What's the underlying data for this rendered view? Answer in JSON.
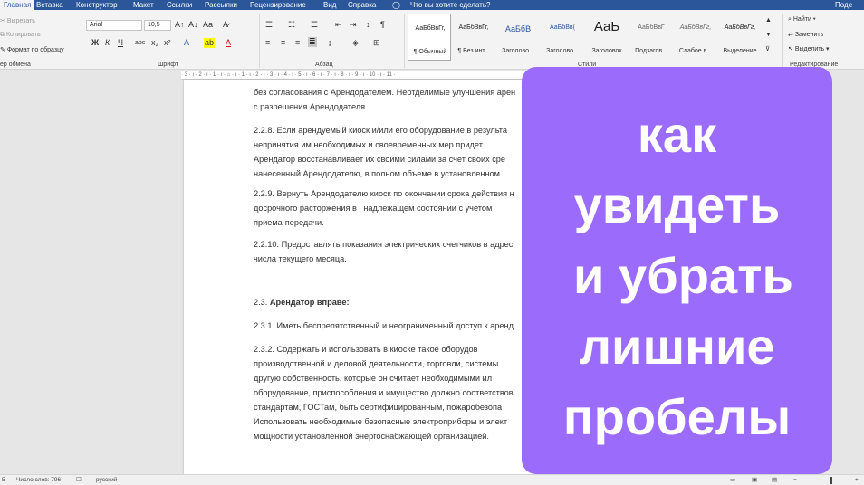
{
  "ribbon_tabs": [
    "Главная",
    "Вставка",
    "Конструктор",
    "Макет",
    "Ссылки",
    "Рассылки",
    "Рецензирование",
    "Вид",
    "Справка"
  ],
  "tell_me": "Что вы хотите сделать?",
  "account": "Поде",
  "clipboard": {
    "cut": "Вырезать",
    "copy": "Копировать",
    "format_painter": "Формат по образцу",
    "group": "ер обмена"
  },
  "font": {
    "name": "Arial",
    "size": "10,5",
    "group": "Шрифт",
    "buttons": [
      "Ж",
      "К",
      "Ч",
      "abc",
      "x₂",
      "x²"
    ]
  },
  "paragraph": {
    "group": "Абзац"
  },
  "styles": {
    "group": "Стили",
    "items": [
      {
        "sample": "АаБбВвГг,",
        "name": "¶ Обычный"
      },
      {
        "sample": "АаБбВвГг,",
        "name": "¶ Без инт..."
      },
      {
        "sample": "АаБбВ",
        "name": "Заголово..."
      },
      {
        "sample": "АаБбВв(",
        "name": "Заголово..."
      },
      {
        "sample": "АаЬ",
        "name": "Заголовок"
      },
      {
        "sample": "АаБбВвГ",
        "name": "Подзагов..."
      },
      {
        "sample": "АаБбВвГг,",
        "name": "Слабое в..."
      },
      {
        "sample": "АаБбВвГг,",
        "name": "Выделение"
      }
    ]
  },
  "editing": {
    "find": "Найти",
    "replace": "Заменить",
    "select": "Выделить",
    "group": "Редактирование"
  },
  "ruler_text": "· 3 · ı · 2 · ı · 1 · ı · ⌂ · ı · 1 · ı · 2 · ı · 3 · ı · 4 · ı · 5 · ı · 6 · ı · 7 · ı · 8 · ı · 9 · ı · 10 · ı · 11 ·",
  "document": {
    "p1": [
      "без согласования с Арендодателем. Неотделимые улучшения арен",
      "с разрешения Арендодателя."
    ],
    "p2": [
      "2.2.8. Если арендуемый киоск и/или его оборудование в результа",
      "непринятия им необходимых и своевременных   мер придет",
      "Арендатор восстанавливает их своими силами за счет своих сре",
      "нанесенный Арендодателю, в полном объеме    в установленном"
    ],
    "p3": [
      "2.2.9. Вернуть Арендодателю киоск по окончании срока действия н",
      "досрочного расторжения в  | надлежащем состоянии с учетом",
      "приема-передачи."
    ],
    "p4": [
      "2.2.10. Предоставлять показания электрических счетчиков в адрес",
      "числа текущего месяца."
    ],
    "p5_num": "2.3.",
    "p5_bold": "Арендатор вправе:",
    "p6": [
      "2.3.1. Иметь беспрепятственный и неограниченный доступ к аренд"
    ],
    "p7": [
      "2.3.2.  Содержать  и  использовать  в  киоске  такое  оборудов",
      "производственной  и  деловой  деятельности,  торговли,  системы",
      "другую  собственность,  которые  он  считает  необходимыми  ил",
      "оборудование, приспособления и имущество должно соответствов",
      "стандартам,  ГОСТам,  быть  сертифицированным,  пожаробезопа",
      "Использовать необходимые безопасные электроприборы и элект",
      "мощности установленной энергоснабжающей организацией."
    ]
  },
  "status": {
    "page": "5",
    "words": "Число слов: 796",
    "language": "русский"
  },
  "overlay": {
    "lines": [
      "как",
      "увидеть",
      "и убрать",
      "лишние",
      "пробелы"
    ],
    "color": "#9b6cfc"
  }
}
